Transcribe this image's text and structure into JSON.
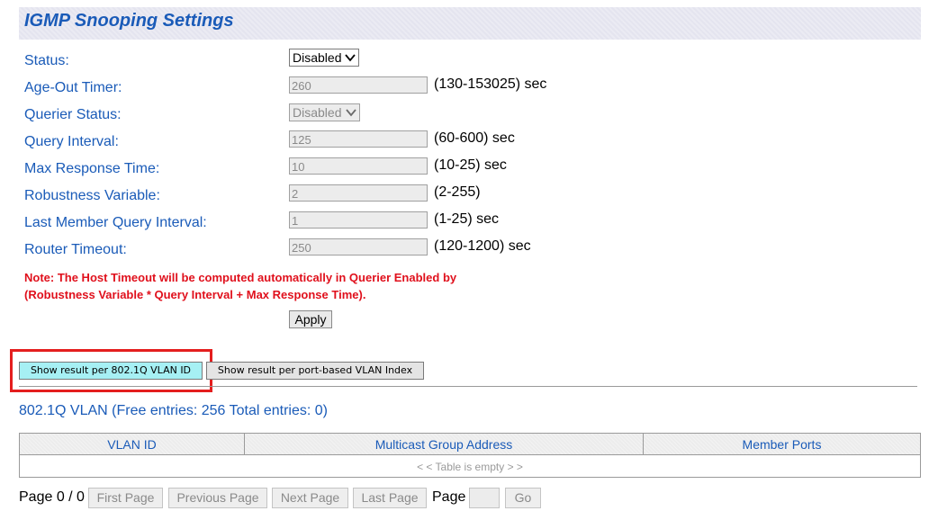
{
  "title": "IGMP Snooping Settings",
  "form": {
    "status": {
      "label": "Status:",
      "value": "Disabled"
    },
    "age_out_timer": {
      "label": "Age-Out Timer:",
      "value": "260",
      "unit": "(130-153025) sec"
    },
    "querier_status": {
      "label": "Querier Status:",
      "value": "Disabled"
    },
    "query_interval": {
      "label": "Query Interval:",
      "value": "125",
      "unit": "(60-600) sec"
    },
    "max_response_time": {
      "label": "Max Response Time:",
      "value": "10",
      "unit": "(10-25) sec"
    },
    "robustness_variable": {
      "label": "Robustness Variable:",
      "value": "2",
      "unit": "(2-255)"
    },
    "last_member_query_interval": {
      "label": "Last Member Query Interval:",
      "value": "1",
      "unit": "(1-25) sec"
    },
    "router_timeout": {
      "label": "Router Timeout:",
      "value": "250",
      "unit": "(120-1200) sec"
    }
  },
  "note": {
    "line1": "Note: The Host Timeout will be computed automatically in Querier Enabled by",
    "line2": "(Robustness Variable * Query Interval + Max Response Time)."
  },
  "apply_label": "Apply",
  "tabs": {
    "dot1q": "Show result per 802.1Q VLAN ID",
    "port_based": "Show result per port-based VLAN Index"
  },
  "vlan_title": "802.1Q VLAN (Free entries: 256 Total entries: 0)",
  "table": {
    "columns": [
      "VLAN ID",
      "Multicast Group Address",
      "Member Ports"
    ],
    "empty_text": "< < Table is empty > >"
  },
  "pager": {
    "page_info": "Page 0 / 0",
    "first": "First Page",
    "previous": "Previous Page",
    "next": "Next Page",
    "last": "Last Page",
    "page_label": "Page",
    "page_input": "",
    "go": "Go"
  },
  "colors": {
    "label_blue": "#1a5bb8",
    "note_red": "#e0101c",
    "highlight_red": "#e41e1e",
    "active_tab_cyan": "#a6f0f4"
  }
}
